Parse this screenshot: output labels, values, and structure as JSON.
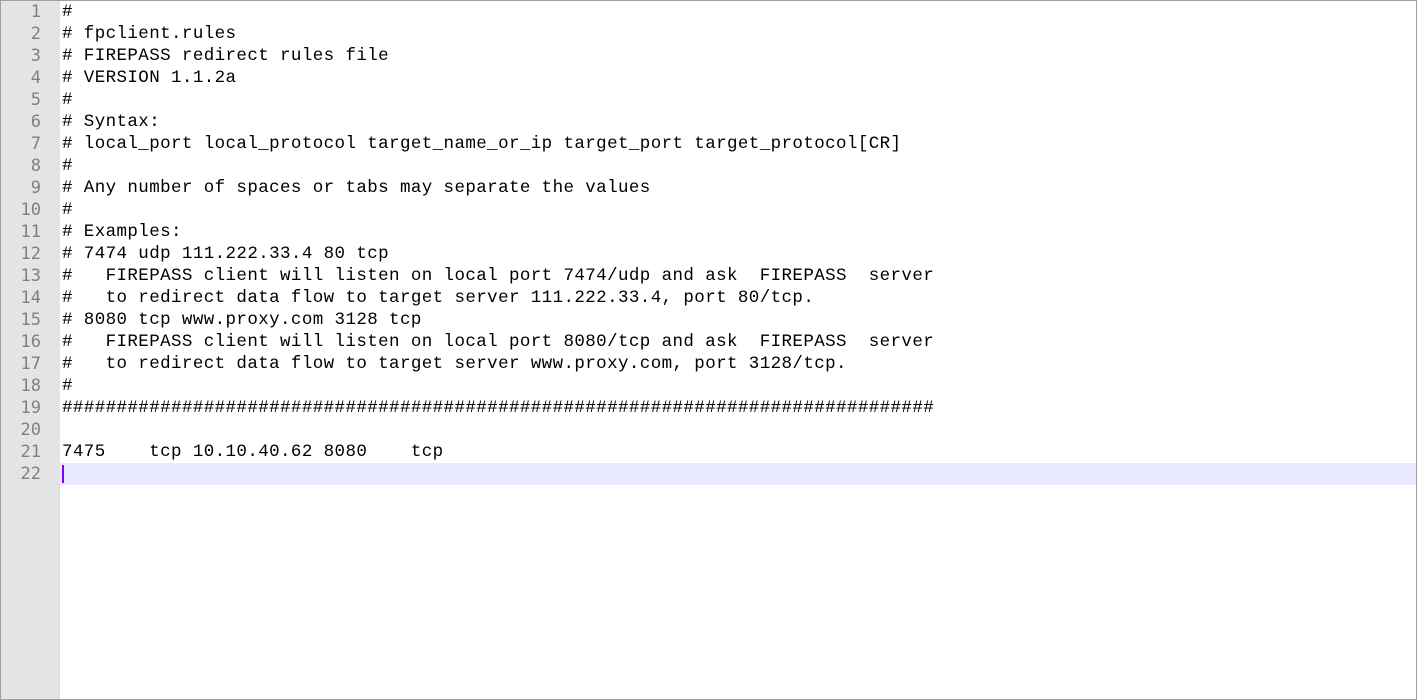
{
  "editor": {
    "lines": [
      {
        "number": "1",
        "text": "#"
      },
      {
        "number": "2",
        "text": "# fpclient.rules"
      },
      {
        "number": "3",
        "text": "# FIREPASS redirect rules file"
      },
      {
        "number": "4",
        "text": "# VERSION 1.1.2a"
      },
      {
        "number": "5",
        "text": "#"
      },
      {
        "number": "6",
        "text": "# Syntax:"
      },
      {
        "number": "7",
        "text": "# local_port local_protocol target_name_or_ip target_port target_protocol[CR]"
      },
      {
        "number": "8",
        "text": "#"
      },
      {
        "number": "9",
        "text": "# Any number of spaces or tabs may separate the values"
      },
      {
        "number": "10",
        "text": "#"
      },
      {
        "number": "11",
        "text": "# Examples:"
      },
      {
        "number": "12",
        "text": "# 7474 udp 111.222.33.4 80 tcp"
      },
      {
        "number": "13",
        "text": "#   FIREPASS client will listen on local port 7474/udp and ask  FIREPASS  server"
      },
      {
        "number": "14",
        "text": "#   to redirect data flow to target server 111.222.33.4, port 80/tcp."
      },
      {
        "number": "15",
        "text": "# 8080 tcp www.proxy.com 3128 tcp"
      },
      {
        "number": "16",
        "text": "#   FIREPASS client will listen on local port 8080/tcp and ask  FIREPASS  server"
      },
      {
        "number": "17",
        "text": "#   to redirect data flow to target server www.proxy.com, port 3128/tcp."
      },
      {
        "number": "18",
        "text": "#"
      },
      {
        "number": "19",
        "text": "################################################################################"
      },
      {
        "number": "20",
        "text": ""
      },
      {
        "number": "21",
        "text": "7475    tcp 10.10.40.62 8080    tcp"
      },
      {
        "number": "22",
        "text": ""
      }
    ],
    "current_line": 22,
    "colors": {
      "gutter_bg": "#e4e4e4",
      "line_number": "#808080",
      "current_line_bg": "#e8e8ff",
      "caret": "#8000ff"
    }
  }
}
